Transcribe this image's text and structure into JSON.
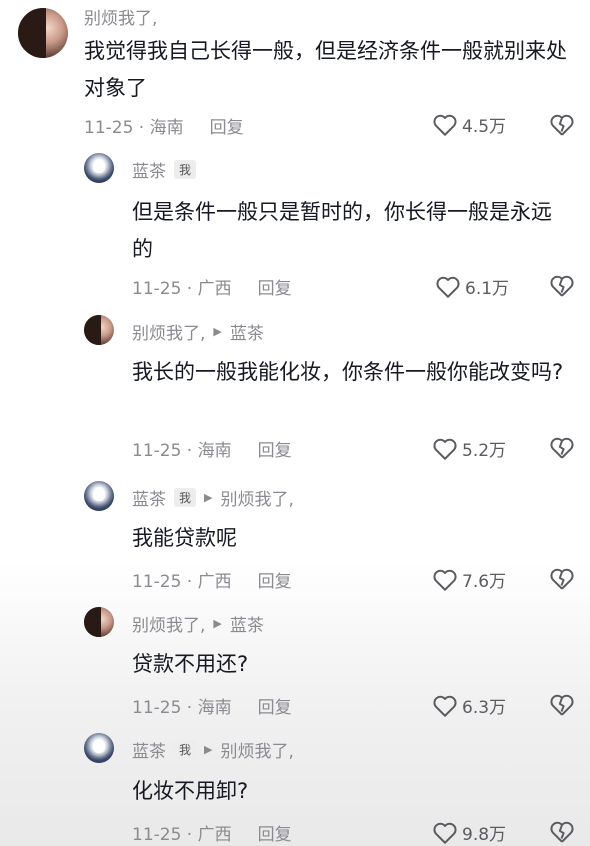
{
  "comments": [
    {
      "user": "别烦我了,",
      "is_me": false,
      "reply_to": "",
      "text": "我觉得我自己长得一般，但是经济条件一般就别来处对象了",
      "date_loc": "11-25 · 海南",
      "reply_label": "回复",
      "likes": "4.5万",
      "avatar": "girl"
    },
    {
      "user": "蓝茶",
      "is_me": true,
      "me_label": "我",
      "reply_to": "",
      "text": "但是条件一般只是暂时的，你长得一般是永远的",
      "date_loc": "11-25 · 广西",
      "reply_label": "回复",
      "likes": "6.1万",
      "avatar": "flower"
    },
    {
      "user": "别烦我了,",
      "is_me": false,
      "reply_to": "蓝茶",
      "text": "我长的一般我能化妆，你条件一般你能改变吗?",
      "date_loc": "11-25 · 海南",
      "reply_label": "回复",
      "likes": "5.2万",
      "avatar": "girl"
    },
    {
      "user": "蓝茶",
      "is_me": true,
      "me_label": "我",
      "reply_to": "别烦我了,",
      "text": "我能贷款呢",
      "date_loc": "11-25 · 广西",
      "reply_label": "回复",
      "likes": "7.6万",
      "avatar": "flower"
    },
    {
      "user": "别烦我了,",
      "is_me": false,
      "reply_to": "蓝茶",
      "text": "贷款不用还?",
      "date_loc": "11-25 · 海南",
      "reply_label": "回复",
      "likes": "6.3万",
      "avatar": "girl"
    },
    {
      "user": "蓝茶",
      "is_me": true,
      "me_label": "我",
      "reply_to": "别烦我了,",
      "text": "化妆不用卸?",
      "date_loc": "11-25 · 广西",
      "reply_label": "回复",
      "likes": "9.8万",
      "avatar": "flower"
    }
  ]
}
